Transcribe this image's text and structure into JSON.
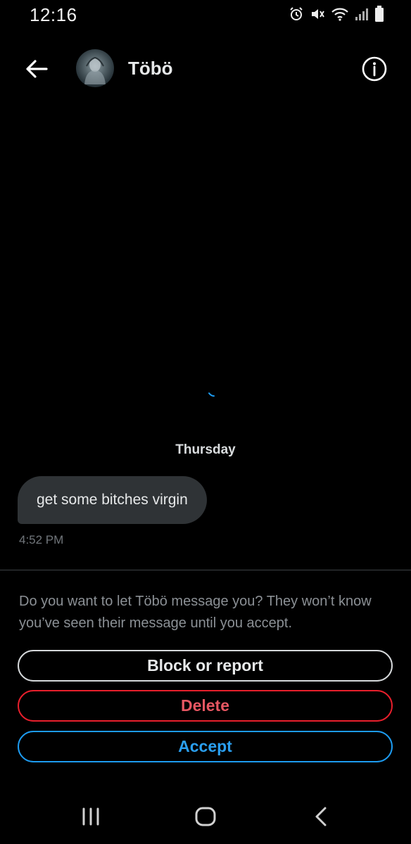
{
  "status_bar": {
    "time": "12:16",
    "icons": [
      "alarm-icon",
      "mute-icon",
      "wifi-icon",
      "signal-icon",
      "battery-icon"
    ]
  },
  "header": {
    "back_icon": "arrow-left-icon",
    "contact_name": "Töbö",
    "info_icon": "info-icon"
  },
  "conversation": {
    "day_label": "Thursday",
    "messages": [
      {
        "text": "get some bitches virgin",
        "time": "4:52 PM"
      }
    ]
  },
  "request": {
    "prompt": "Do you want to let Töbö message you? They won’t know you’ve seen their message until you accept.",
    "block_label": "Block or report",
    "delete_label": "Delete",
    "accept_label": "Accept"
  },
  "nav_bar": {
    "icons": [
      "recent-apps-icon",
      "home-icon",
      "back-icon"
    ]
  },
  "colors": {
    "background": "#000000",
    "bubble": "#2f3336",
    "delete": "#f4212e",
    "accept": "#1d9bf0",
    "muted_text": "#71767b"
  }
}
